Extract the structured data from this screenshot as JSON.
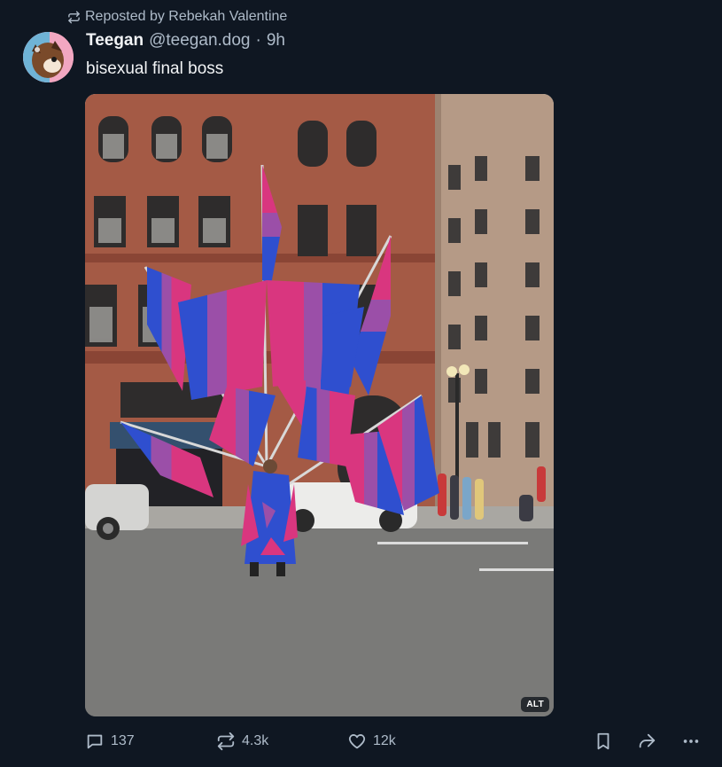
{
  "repost": {
    "label": "Reposted by Rebekah Valentine",
    "icon": "repost-icon"
  },
  "author": {
    "display_name": "Teegan",
    "handle": "@teegan.dog",
    "separator": "·",
    "time": "9h",
    "avatar": "avatar-icon"
  },
  "post": {
    "text": "bisexual final boss"
  },
  "media": {
    "alt_badge": "ALT",
    "colors": {
      "bi_pink": "#d9367f",
      "bi_purple": "#9b4fa8",
      "bi_blue": "#2f4fcf",
      "brick": "#a45a45",
      "stone": "#b59a86",
      "road": "#7a7a78"
    }
  },
  "actions": {
    "reply_count": "137",
    "repost_count": "4.3k",
    "like_count": "12k"
  },
  "colors": {
    "background": "#0f1722",
    "text": "#f1f3f5",
    "muted": "#aebbc9"
  }
}
